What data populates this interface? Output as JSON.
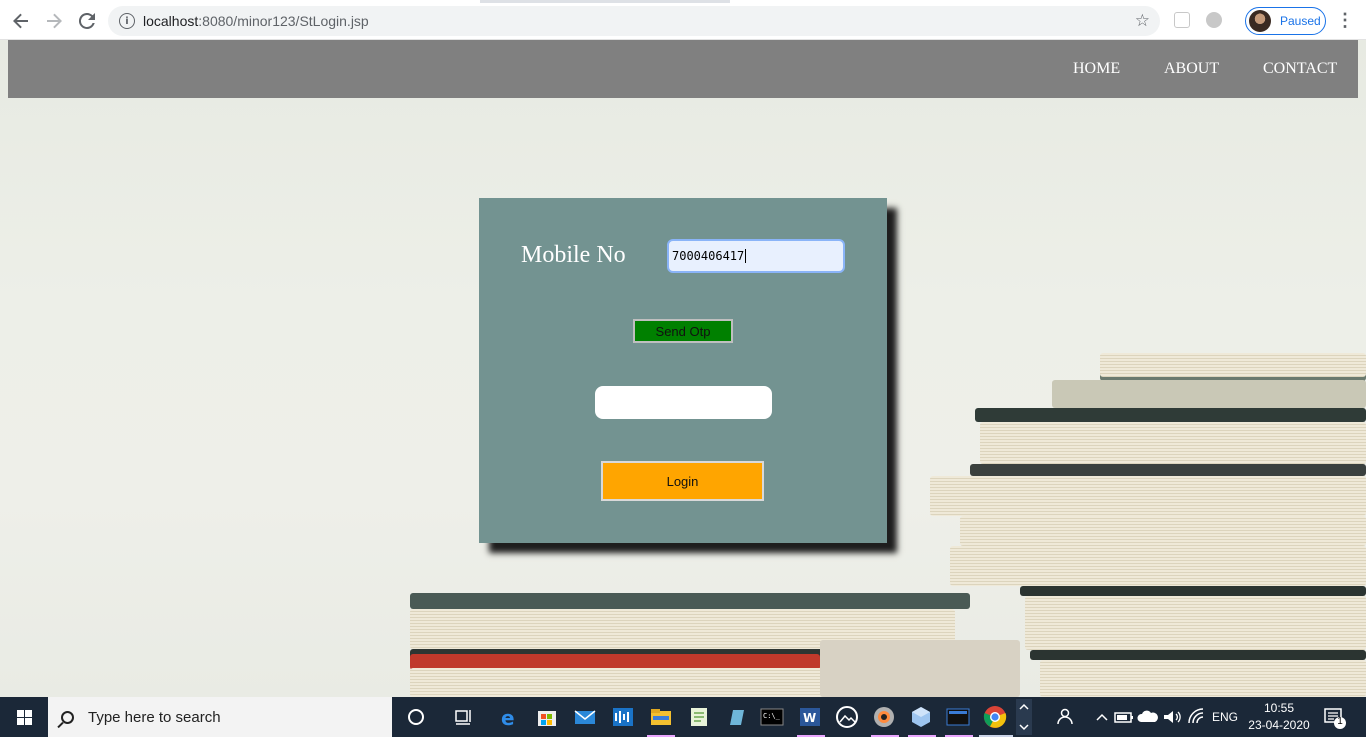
{
  "browser": {
    "url_host": "localhost",
    "url_path": ":8080/minor123/StLogin.jsp",
    "profile_status": "Paused"
  },
  "site_nav": {
    "items": [
      {
        "label": "HOME"
      },
      {
        "label": "ABOUT"
      },
      {
        "label": "CONTACT"
      }
    ]
  },
  "login_form": {
    "mobile_label": "Mobile No",
    "mobile_value": "7000406417",
    "send_otp_label": "Send Otp",
    "otp_value": "",
    "login_label": "Login"
  },
  "colors": {
    "panel": "#739391",
    "send_otp": "#008000",
    "login": "#ffa500",
    "nav": "#808080"
  },
  "taskbar": {
    "search_placeholder": "Type here to search",
    "language": "ENG",
    "time": "10:55",
    "date": "23-04-2020",
    "notification_count": "1"
  }
}
